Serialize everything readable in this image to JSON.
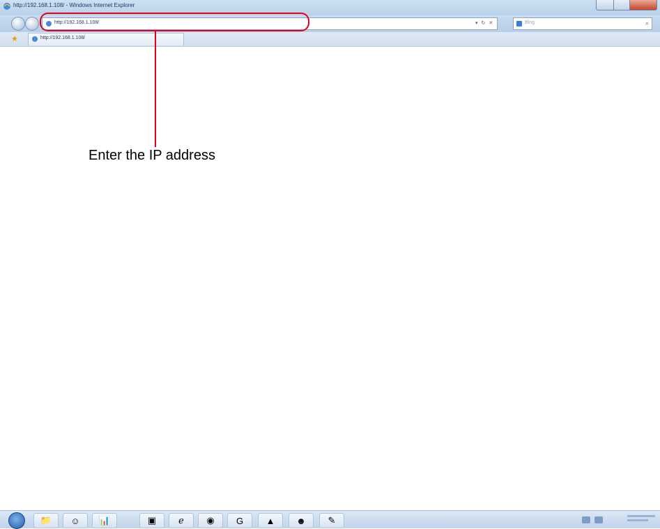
{
  "window": {
    "title": "http://192.168.1.108/ - Windows Internet Explorer"
  },
  "address_bar": {
    "url": "http://192.168.1.108/"
  },
  "search": {
    "placeholder": "Bing"
  },
  "favorites_bar": {
    "tab_label": "http://192.168.1.108/"
  },
  "callout": {
    "text": "Enter the IP address",
    "color": "#e3001b"
  },
  "icons": {
    "ie": "internet-explorer-icon",
    "back": "back-icon",
    "forward": "forward-icon",
    "refresh": "refresh-icon",
    "stop": "stop-icon",
    "search": "magnifier-icon",
    "favorites": "star-icon"
  },
  "taskbar": {
    "items": [
      "start",
      "explorer",
      "smiley",
      "chart",
      "app",
      "internet-explorer",
      "chrome",
      "graphics-app",
      "image-editor",
      "user-app",
      "notepad"
    ]
  }
}
